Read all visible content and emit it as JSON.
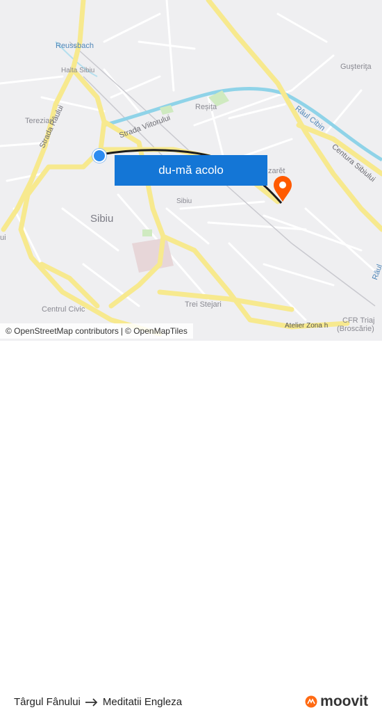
{
  "map": {
    "cta_label": "du-mă acolo",
    "place_labels": [
      {
        "key": "reussbach",
        "text": "Reussbach"
      },
      {
        "key": "halta",
        "text": "Halta Sibiu"
      },
      {
        "key": "terezian",
        "text": "Terezian"
      },
      {
        "key": "resita",
        "text": "Reșița"
      },
      {
        "key": "gusterita",
        "text": "Guşteriţa"
      },
      {
        "key": "sibiu-big",
        "text": "Sibiu"
      },
      {
        "key": "sibiu-small",
        "text": "Sibiu"
      },
      {
        "key": "centrul",
        "text": "Centrul Civic"
      },
      {
        "key": "trei",
        "text": "Trei Stejari"
      },
      {
        "key": "atelier",
        "text": "Atelier Zona h"
      },
      {
        "key": "cfr",
        "text": "CFR Triaj"
      },
      {
        "key": "broscarie",
        "text": "(Broscărie)"
      },
      {
        "key": "nazaret",
        "text": "zarět"
      }
    ],
    "street_labels": [
      {
        "key": "raului",
        "text": "Strada Râului"
      },
      {
        "key": "viitorului",
        "text": "Strada Viitorului"
      },
      {
        "key": "cibin",
        "text": "Râul Cibin"
      },
      {
        "key": "centura",
        "text": "Centura Sibiului"
      },
      {
        "key": "raul-edge",
        "text": "Râul"
      },
      {
        "key": "left-edge",
        "text": "ui"
      }
    ],
    "colors": {
      "background": "#efeff1",
      "major_road": "#f7e98e",
      "minor_road": "#ffffff",
      "river": "#8fd3e8",
      "route_line": "#1d1d1d",
      "cta": "#1476d6",
      "destination_pin": "#ff5a00",
      "origin_dot": "#2d8cf0"
    },
    "attribution": {
      "osm": "© OpenStreetMap contributors",
      "separator": "|",
      "omt": "© OpenMapTiles"
    }
  },
  "footer": {
    "origin": "Târgul Fânului",
    "arrow_icon": "arrow-right-icon",
    "destination": "Meditatii Engleza",
    "brand": "moovit"
  }
}
